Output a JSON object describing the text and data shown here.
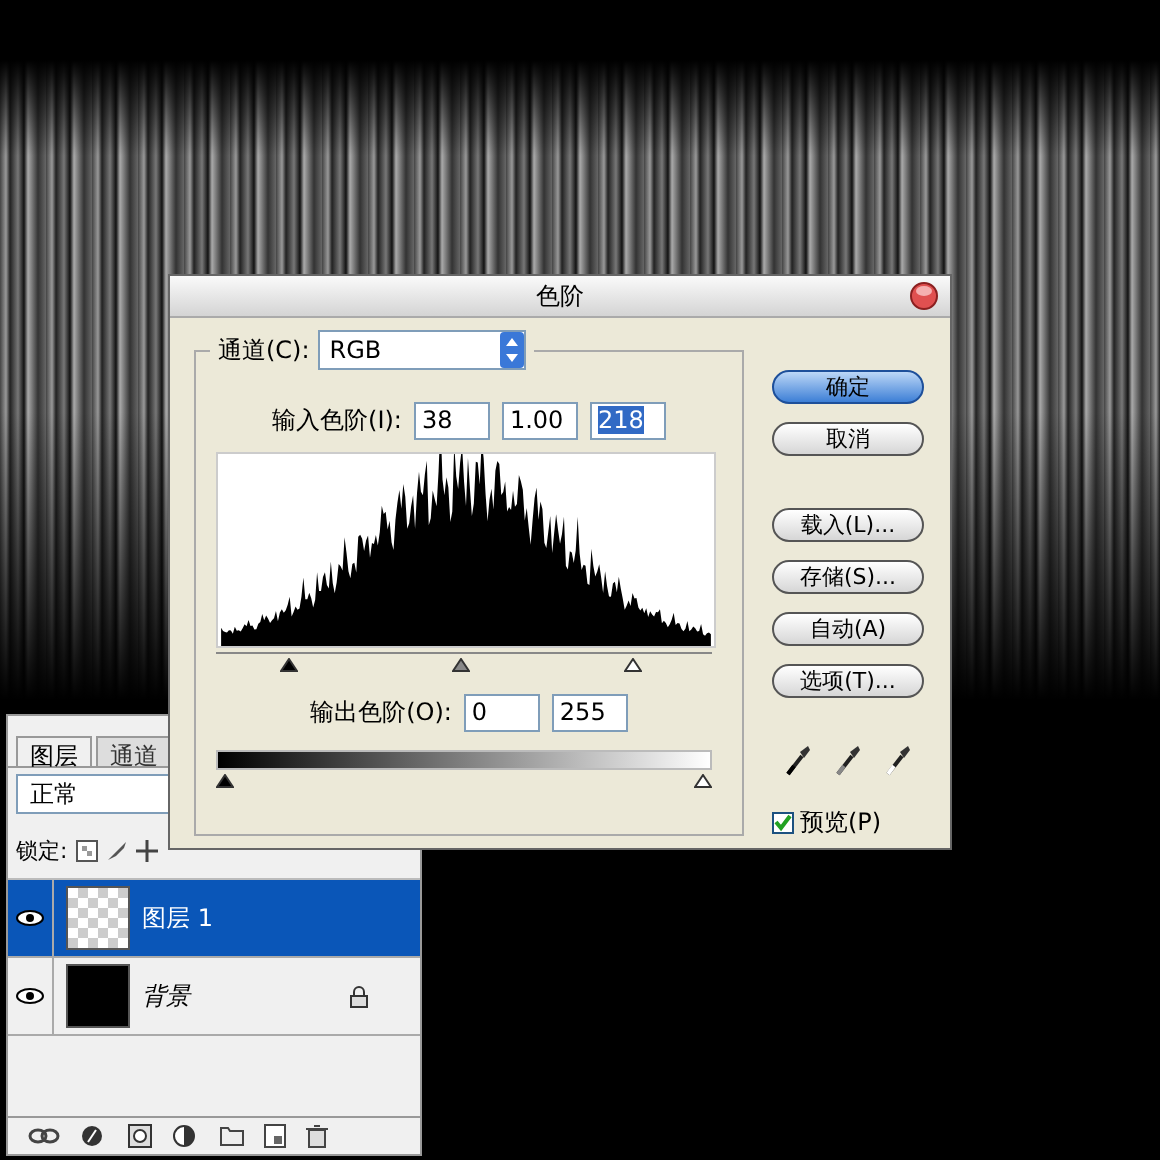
{
  "dialog": {
    "title": "色阶",
    "channel": {
      "label": "通道(C):",
      "value": "RGB"
    },
    "input_levels": {
      "label": "输入色阶(I):",
      "values": [
        {
          "text": "38",
          "selected": false
        },
        {
          "text": "1.00",
          "selected": false
        },
        {
          "text": "218",
          "selected": true
        }
      ]
    },
    "output_levels": {
      "label": "输出色阶(O):",
      "values": [
        "0",
        "255"
      ]
    },
    "buttons": [
      {
        "label": "确定",
        "default": true
      },
      {
        "label": "取消",
        "default": false
      },
      {
        "label": "载入(L)...",
        "default": false
      },
      {
        "label": "存储(S)...",
        "default": false
      },
      {
        "label": "自动(A)",
        "default": false
      },
      {
        "label": "选项(T)...",
        "default": false
      }
    ],
    "preview": {
      "label": "预览(P)",
      "checked": true
    }
  },
  "layers_panel": {
    "tabs": [
      {
        "label": "图层",
        "selected": true
      },
      {
        "label": "通道",
        "selected": false
      }
    ],
    "blend_mode": "正常",
    "lock_label": "锁定:",
    "layers": [
      {
        "name": "图层 1",
        "kind": "transparent",
        "selected": true,
        "visible": true,
        "locked": false
      },
      {
        "name": "背景",
        "kind": "black",
        "selected": false,
        "visible": true,
        "locked": true
      }
    ]
  }
}
